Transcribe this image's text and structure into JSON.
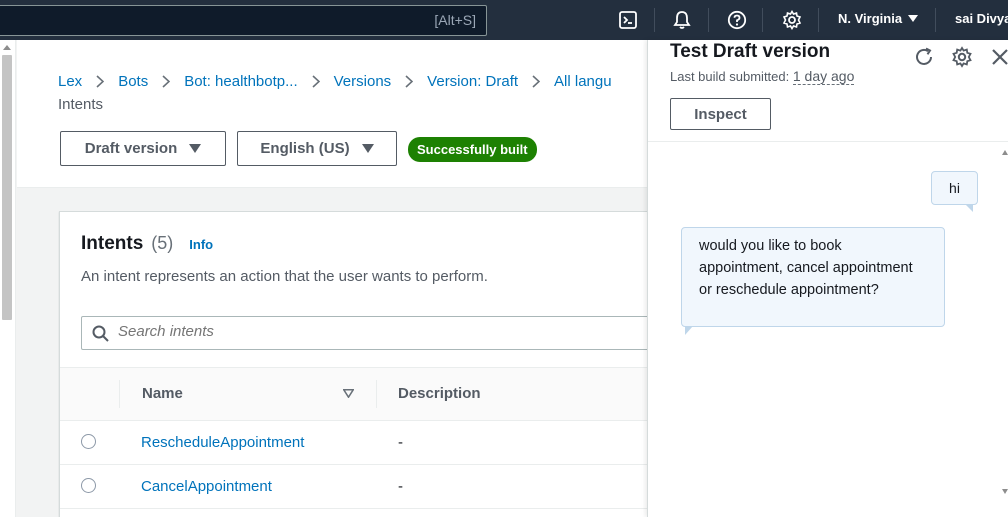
{
  "topnav": {
    "search_shortcut": "[Alt+S]",
    "region": "N. Virginia",
    "user": "sai Divya",
    "icons": [
      "cloudshell-icon",
      "bell-icon",
      "help-icon",
      "settings-icon"
    ]
  },
  "breadcrumb": {
    "items": [
      "Lex",
      "Bots",
      "Bot: healthbotp...",
      "Versions",
      "Version: Draft",
      "All langu"
    ],
    "tail": "Intents"
  },
  "header": {
    "version_select": "Draft version",
    "language_select": "English (US)",
    "status_badge": "Successfully built",
    "status_color": "#1d8102"
  },
  "intents": {
    "title": "Intents",
    "count": "(5)",
    "info_link": "Info",
    "description": "An intent represents an action that the user wants to perform.",
    "search_placeholder": "Search intents",
    "columns": [
      "Name",
      "Description"
    ],
    "rows": [
      {
        "name": "RescheduleAppointment",
        "description": "-"
      },
      {
        "name": "CancelAppointment",
        "description": "-"
      }
    ]
  },
  "test_panel": {
    "title": "Test Draft version",
    "subtitle_label": "Last build submitted:",
    "subtitle_value": "1 day ago",
    "inspect_label": "Inspect",
    "messages": [
      {
        "from": "user",
        "text": "hi"
      },
      {
        "from": "bot",
        "text": "would you like to book appointment, cancel appointment or reschedule appointment?"
      }
    ]
  },
  "colors": {
    "nav_bg": "#232f3e",
    "link": "#0073bb",
    "chat_bubble": "#f1f7fd"
  }
}
